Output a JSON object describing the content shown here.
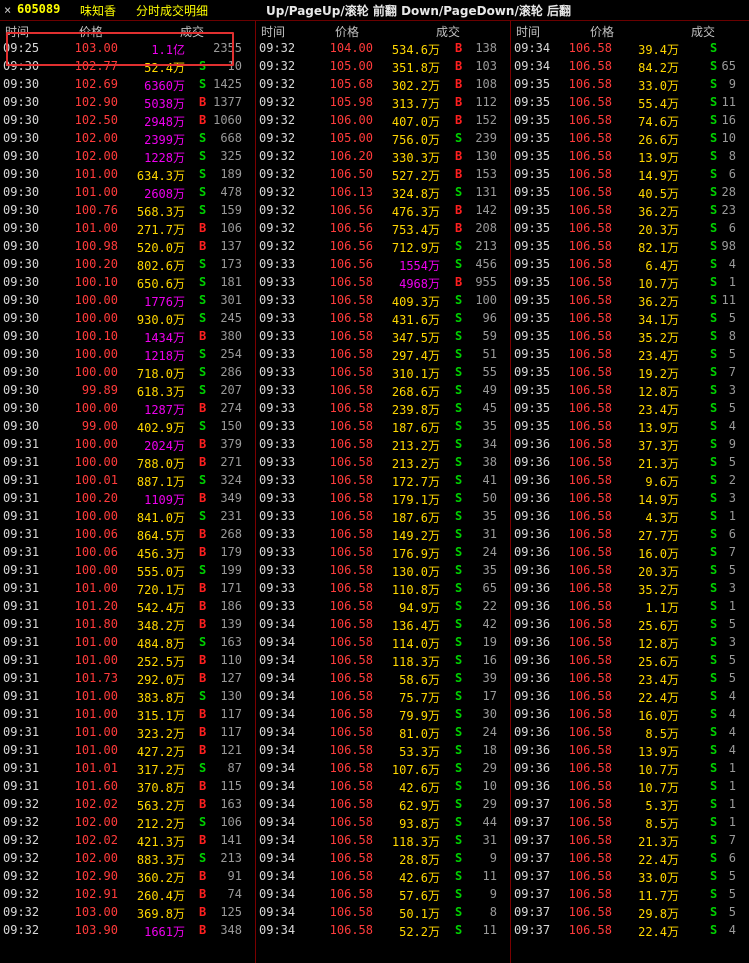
{
  "window": {
    "close_glyph": "×",
    "stock_code": "605089",
    "stock_name": "味知香",
    "panel_title": "分时成交明细",
    "key_hint": "Up/PageUp/滚轮 前翻 Down/PageDown/滚轮 后翻"
  },
  "columns": {
    "time": "时间",
    "price": "价格",
    "volume": "成交"
  },
  "colors": {
    "up_price": "#ff3b3b",
    "buy": "#ff2020",
    "sell": "#00d000",
    "volume_small": "#ffd700",
    "volume_large": "#ee00ee",
    "separator": "#7a0000",
    "highlight_box": "#e03030"
  },
  "panels": [
    {
      "rows": [
        [
          "09:25",
          "103.00",
          "1.1亿",
          "",
          "2355"
        ],
        [
          "09:30",
          "102.77",
          "52.4万",
          "S",
          "10"
        ],
        [
          "09:30",
          "102.69",
          "6360万",
          "S",
          "1425"
        ],
        [
          "09:30",
          "102.90",
          "5038万",
          "B",
          "1377"
        ],
        [
          "09:30",
          "102.50",
          "2948万",
          "B",
          "1060"
        ],
        [
          "09:30",
          "102.00",
          "2399万",
          "S",
          "668"
        ],
        [
          "09:30",
          "102.00",
          "1228万",
          "S",
          "325"
        ],
        [
          "09:30",
          "101.00",
          "634.3万",
          "S",
          "189"
        ],
        [
          "09:30",
          "101.00",
          "2608万",
          "S",
          "478"
        ],
        [
          "09:30",
          "100.76",
          "568.3万",
          "S",
          "159"
        ],
        [
          "09:30",
          "101.00",
          "271.7万",
          "B",
          "106"
        ],
        [
          "09:30",
          "100.98",
          "520.0万",
          "B",
          "137"
        ],
        [
          "09:30",
          "100.20",
          "802.6万",
          "S",
          "173"
        ],
        [
          "09:30",
          "100.10",
          "650.6万",
          "S",
          "181"
        ],
        [
          "09:30",
          "100.00",
          "1776万",
          "S",
          "301"
        ],
        [
          "09:30",
          "100.00",
          "930.0万",
          "S",
          "245"
        ],
        [
          "09:30",
          "100.10",
          "1434万",
          "B",
          "380"
        ],
        [
          "09:30",
          "100.00",
          "1218万",
          "S",
          "254"
        ],
        [
          "09:30",
          "100.00",
          "718.0万",
          "S",
          "286"
        ],
        [
          "09:30",
          "99.89",
          "618.3万",
          "S",
          "207"
        ],
        [
          "09:30",
          "100.00",
          "1287万",
          "B",
          "274"
        ],
        [
          "09:30",
          "99.00",
          "402.9万",
          "S",
          "150"
        ],
        [
          "09:31",
          "100.00",
          "2024万",
          "B",
          "379"
        ],
        [
          "09:31",
          "100.00",
          "788.0万",
          "B",
          "271"
        ],
        [
          "09:31",
          "100.01",
          "887.1万",
          "S",
          "324"
        ],
        [
          "09:31",
          "100.20",
          "1109万",
          "B",
          "349"
        ],
        [
          "09:31",
          "100.00",
          "841.0万",
          "S",
          "231"
        ],
        [
          "09:31",
          "100.06",
          "864.5万",
          "B",
          "268"
        ],
        [
          "09:31",
          "100.06",
          "456.3万",
          "B",
          "179"
        ],
        [
          "09:31",
          "100.00",
          "555.0万",
          "S",
          "199"
        ],
        [
          "09:31",
          "101.00",
          "720.1万",
          "B",
          "171"
        ],
        [
          "09:31",
          "101.20",
          "542.4万",
          "B",
          "186"
        ],
        [
          "09:31",
          "101.80",
          "348.2万",
          "B",
          "139"
        ],
        [
          "09:31",
          "101.00",
          "484.8万",
          "S",
          "163"
        ],
        [
          "09:31",
          "101.00",
          "252.5万",
          "B",
          "110"
        ],
        [
          "09:31",
          "101.73",
          "292.0万",
          "B",
          "127"
        ],
        [
          "09:31",
          "101.00",
          "383.8万",
          "S",
          "130"
        ],
        [
          "09:31",
          "101.00",
          "315.1万",
          "B",
          "117"
        ],
        [
          "09:31",
          "101.00",
          "323.2万",
          "B",
          "117"
        ],
        [
          "09:31",
          "101.00",
          "427.2万",
          "B",
          "121"
        ],
        [
          "09:31",
          "101.01",
          "317.2万",
          "S",
          "87"
        ],
        [
          "09:31",
          "101.60",
          "370.8万",
          "B",
          "115"
        ],
        [
          "09:32",
          "102.02",
          "563.2万",
          "B",
          "163"
        ],
        [
          "09:32",
          "102.00",
          "212.2万",
          "S",
          "106"
        ],
        [
          "09:32",
          "102.02",
          "421.3万",
          "B",
          "141"
        ],
        [
          "09:32",
          "102.00",
          "883.3万",
          "S",
          "213"
        ],
        [
          "09:32",
          "102.90",
          "360.2万",
          "B",
          "91"
        ],
        [
          "09:32",
          "102.91",
          "260.4万",
          "B",
          "74"
        ],
        [
          "09:32",
          "103.00",
          "369.8万",
          "B",
          "125"
        ],
        [
          "09:32",
          "103.90",
          "1661万",
          "B",
          "348"
        ]
      ]
    },
    {
      "rows": [
        [
          "09:32",
          "104.00",
          "534.6万",
          "B",
          "138"
        ],
        [
          "09:32",
          "105.00",
          "351.8万",
          "B",
          "103"
        ],
        [
          "09:32",
          "105.68",
          "302.2万",
          "B",
          "108"
        ],
        [
          "09:32",
          "105.98",
          "313.7万",
          "B",
          "112"
        ],
        [
          "09:32",
          "106.00",
          "407.0万",
          "B",
          "152"
        ],
        [
          "09:32",
          "105.00",
          "756.0万",
          "S",
          "239"
        ],
        [
          "09:32",
          "106.20",
          "330.3万",
          "B",
          "130"
        ],
        [
          "09:32",
          "106.50",
          "527.2万",
          "B",
          "153"
        ],
        [
          "09:32",
          "106.13",
          "324.8万",
          "S",
          "131"
        ],
        [
          "09:32",
          "106.56",
          "476.3万",
          "B",
          "142"
        ],
        [
          "09:32",
          "106.56",
          "753.4万",
          "B",
          "208"
        ],
        [
          "09:32",
          "106.56",
          "712.9万",
          "S",
          "213"
        ],
        [
          "09:33",
          "106.56",
          "1554万",
          "S",
          "456"
        ],
        [
          "09:33",
          "106.58",
          "4968万",
          "B",
          "955"
        ],
        [
          "09:33",
          "106.58",
          "409.3万",
          "S",
          "100"
        ],
        [
          "09:33",
          "106.58",
          "431.6万",
          "S",
          "96"
        ],
        [
          "09:33",
          "106.58",
          "347.5万",
          "S",
          "59"
        ],
        [
          "09:33",
          "106.58",
          "297.4万",
          "S",
          "51"
        ],
        [
          "09:33",
          "106.58",
          "310.1万",
          "S",
          "55"
        ],
        [
          "09:33",
          "106.58",
          "268.6万",
          "S",
          "49"
        ],
        [
          "09:33",
          "106.58",
          "239.8万",
          "S",
          "45"
        ],
        [
          "09:33",
          "106.58",
          "187.6万",
          "S",
          "35"
        ],
        [
          "09:33",
          "106.58",
          "213.2万",
          "S",
          "34"
        ],
        [
          "09:33",
          "106.58",
          "213.2万",
          "S",
          "38"
        ],
        [
          "09:33",
          "106.58",
          "172.7万",
          "S",
          "41"
        ],
        [
          "09:33",
          "106.58",
          "179.1万",
          "S",
          "50"
        ],
        [
          "09:33",
          "106.58",
          "187.6万",
          "S",
          "35"
        ],
        [
          "09:33",
          "106.58",
          "149.2万",
          "S",
          "31"
        ],
        [
          "09:33",
          "106.58",
          "176.9万",
          "S",
          "24"
        ],
        [
          "09:33",
          "106.58",
          "130.0万",
          "S",
          "35"
        ],
        [
          "09:33",
          "106.58",
          "110.8万",
          "S",
          "65"
        ],
        [
          "09:33",
          "106.58",
          "94.9万",
          "S",
          "22"
        ],
        [
          "09:34",
          "106.58",
          "136.4万",
          "S",
          "42"
        ],
        [
          "09:34",
          "106.58",
          "114.0万",
          "S",
          "19"
        ],
        [
          "09:34",
          "106.58",
          "118.3万",
          "S",
          "16"
        ],
        [
          "09:34",
          "106.58",
          "58.6万",
          "S",
          "39"
        ],
        [
          "09:34",
          "106.58",
          "75.7万",
          "S",
          "17"
        ],
        [
          "09:34",
          "106.58",
          "79.9万",
          "S",
          "30"
        ],
        [
          "09:34",
          "106.58",
          "81.0万",
          "S",
          "24"
        ],
        [
          "09:34",
          "106.58",
          "53.3万",
          "S",
          "18"
        ],
        [
          "09:34",
          "106.58",
          "107.6万",
          "S",
          "29"
        ],
        [
          "09:34",
          "106.58",
          "42.6万",
          "S",
          "10"
        ],
        [
          "09:34",
          "106.58",
          "62.9万",
          "S",
          "29"
        ],
        [
          "09:34",
          "106.58",
          "93.8万",
          "S",
          "44"
        ],
        [
          "09:34",
          "106.58",
          "118.3万",
          "S",
          "31"
        ],
        [
          "09:34",
          "106.58",
          "28.8万",
          "S",
          "9"
        ],
        [
          "09:34",
          "106.58",
          "42.6万",
          "S",
          "11"
        ],
        [
          "09:34",
          "106.58",
          "57.6万",
          "S",
          "9"
        ],
        [
          "09:34",
          "106.58",
          "50.1万",
          "S",
          "8"
        ],
        [
          "09:34",
          "106.58",
          "52.2万",
          "S",
          "11"
        ]
      ]
    },
    {
      "rows": [
        [
          "09:34",
          "106.58",
          "39.4万",
          "S",
          ""
        ],
        [
          "09:34",
          "106.58",
          "84.2万",
          "S",
          "65"
        ],
        [
          "09:35",
          "106.58",
          "33.0万",
          "S",
          "9"
        ],
        [
          "09:35",
          "106.58",
          "55.4万",
          "S",
          "11"
        ],
        [
          "09:35",
          "106.58",
          "74.6万",
          "S",
          "16"
        ],
        [
          "09:35",
          "106.58",
          "26.6万",
          "S",
          "10"
        ],
        [
          "09:35",
          "106.58",
          "13.9万",
          "S",
          "8"
        ],
        [
          "09:35",
          "106.58",
          "14.9万",
          "S",
          "6"
        ],
        [
          "09:35",
          "106.58",
          "40.5万",
          "S",
          "28"
        ],
        [
          "09:35",
          "106.58",
          "36.2万",
          "S",
          "23"
        ],
        [
          "09:35",
          "106.58",
          "20.3万",
          "S",
          "6"
        ],
        [
          "09:35",
          "106.58",
          "82.1万",
          "S",
          "98"
        ],
        [
          "09:35",
          "106.58",
          "6.4万",
          "S",
          "4"
        ],
        [
          "09:35",
          "106.58",
          "10.7万",
          "S",
          "1"
        ],
        [
          "09:35",
          "106.58",
          "36.2万",
          "S",
          "11"
        ],
        [
          "09:35",
          "106.58",
          "34.1万",
          "S",
          "5"
        ],
        [
          "09:35",
          "106.58",
          "35.2万",
          "S",
          "8"
        ],
        [
          "09:35",
          "106.58",
          "23.4万",
          "S",
          "5"
        ],
        [
          "09:35",
          "106.58",
          "19.2万",
          "S",
          "7"
        ],
        [
          "09:35",
          "106.58",
          "12.8万",
          "S",
          "3"
        ],
        [
          "09:35",
          "106.58",
          "23.4万",
          "S",
          "5"
        ],
        [
          "09:35",
          "106.58",
          "13.9万",
          "S",
          "4"
        ],
        [
          "09:36",
          "106.58",
          "37.3万",
          "S",
          "9"
        ],
        [
          "09:36",
          "106.58",
          "21.3万",
          "S",
          "5"
        ],
        [
          "09:36",
          "106.58",
          "9.6万",
          "S",
          "2"
        ],
        [
          "09:36",
          "106.58",
          "14.9万",
          "S",
          "3"
        ],
        [
          "09:36",
          "106.58",
          "4.3万",
          "S",
          "1"
        ],
        [
          "09:36",
          "106.58",
          "27.7万",
          "S",
          "6"
        ],
        [
          "09:36",
          "106.58",
          "16.0万",
          "S",
          "7"
        ],
        [
          "09:36",
          "106.58",
          "20.3万",
          "S",
          "5"
        ],
        [
          "09:36",
          "106.58",
          "35.2万",
          "S",
          "3"
        ],
        [
          "09:36",
          "106.58",
          "1.1万",
          "S",
          "1"
        ],
        [
          "09:36",
          "106.58",
          "25.6万",
          "S",
          "5"
        ],
        [
          "09:36",
          "106.58",
          "12.8万",
          "S",
          "3"
        ],
        [
          "09:36",
          "106.58",
          "25.6万",
          "S",
          "5"
        ],
        [
          "09:36",
          "106.58",
          "23.4万",
          "S",
          "5"
        ],
        [
          "09:36",
          "106.58",
          "22.4万",
          "S",
          "4"
        ],
        [
          "09:36",
          "106.58",
          "16.0万",
          "S",
          "4"
        ],
        [
          "09:36",
          "106.58",
          "8.5万",
          "S",
          "4"
        ],
        [
          "09:36",
          "106.58",
          "13.9万",
          "S",
          "4"
        ],
        [
          "09:36",
          "106.58",
          "10.7万",
          "S",
          "1"
        ],
        [
          "09:36",
          "106.58",
          "10.7万",
          "S",
          "1"
        ],
        [
          "09:37",
          "106.58",
          "5.3万",
          "S",
          "1"
        ],
        [
          "09:37",
          "106.58",
          "8.5万",
          "S",
          "1"
        ],
        [
          "09:37",
          "106.58",
          "21.3万",
          "S",
          "7"
        ],
        [
          "09:37",
          "106.58",
          "22.4万",
          "S",
          "6"
        ],
        [
          "09:37",
          "106.58",
          "33.0万",
          "S",
          "5"
        ],
        [
          "09:37",
          "106.58",
          "11.7万",
          "S",
          "5"
        ],
        [
          "09:37",
          "106.58",
          "29.8万",
          "S",
          "5"
        ],
        [
          "09:37",
          "106.58",
          "22.4万",
          "S",
          "4"
        ]
      ]
    }
  ]
}
